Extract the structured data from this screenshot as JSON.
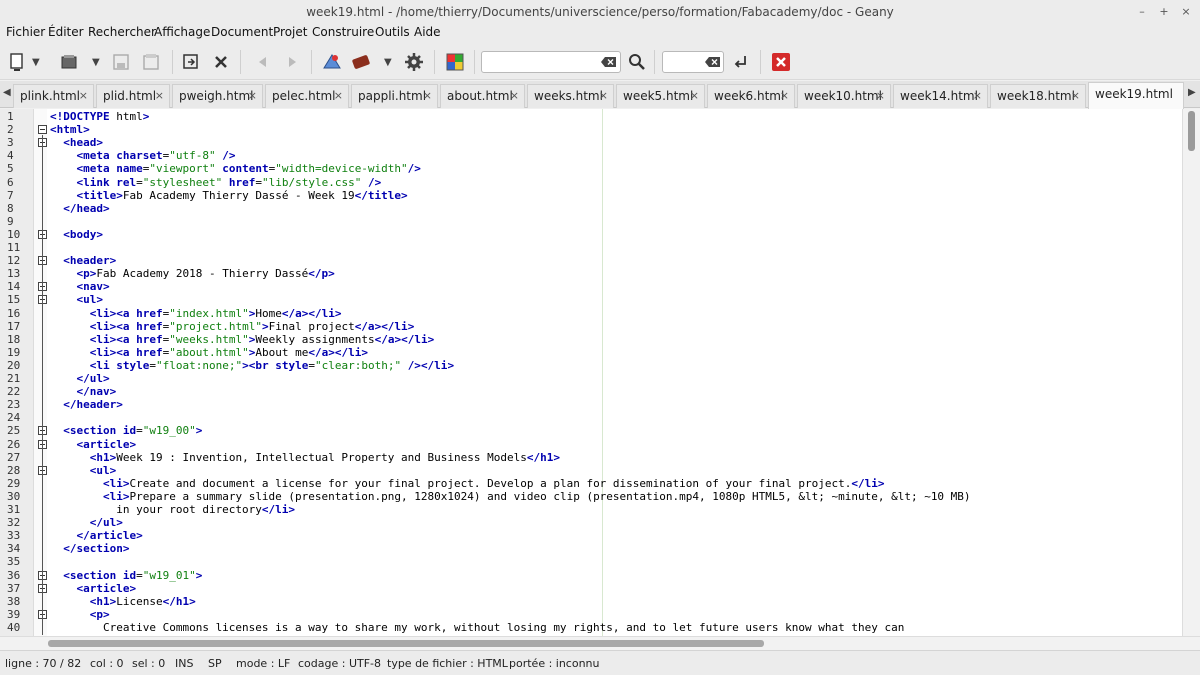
{
  "window": {
    "title": "week19.html - /home/thierry/Documents/universcience/perso/formation/Fabacademy/doc - Geany",
    "minimize": "–",
    "maximize": "+",
    "close": "×"
  },
  "menu": [
    "Fichier",
    "Éditer",
    "Rechercher",
    "Affichage",
    "Document",
    "Projet",
    "Construire",
    "Outils",
    "Aide"
  ],
  "toolbar": {
    "search_value": "",
    "goto_value": "",
    "icons": [
      "new-file-icon",
      "open-file-icon",
      "save-icon",
      "save-all-icon",
      "revert-icon",
      "close-file-icon",
      "back-icon",
      "forward-icon",
      "compile-icon",
      "build-icon",
      "preferences-icon",
      "color-chooser-icon",
      "search-icon",
      "goto-line-icon",
      "quit-icon"
    ]
  },
  "tabs": [
    {
      "label": "plink.html",
      "active": false
    },
    {
      "label": "plid.html",
      "active": false
    },
    {
      "label": "pweigh.html",
      "active": false
    },
    {
      "label": "pelec.html",
      "active": false
    },
    {
      "label": "pappli.html",
      "active": false
    },
    {
      "label": "about.html",
      "active": false
    },
    {
      "label": "weeks.html",
      "active": false
    },
    {
      "label": "week5.html",
      "active": false
    },
    {
      "label": "week6.html",
      "active": false
    },
    {
      "label": "week10.html",
      "active": false
    },
    {
      "label": "week14.html",
      "active": false
    },
    {
      "label": "week18.html",
      "active": false
    },
    {
      "label": "week19.html",
      "active": true
    }
  ],
  "tab_close_glyph": "×",
  "editor": {
    "lines": [
      "<!DOCTYPE html>",
      "<html>",
      "  <head>",
      "    <meta charset=\"utf-8\" />",
      "    <meta name=\"viewport\" content=\"width=device-width\"/>",
      "    <link rel=\"stylesheet\" href=\"lib/style.css\" />",
      "    <title>Fab Academy Thierry Dassé - Week 19</title>",
      "  </head>",
      "",
      "  <body>",
      "",
      "  <header>",
      "    <p>Fab Academy 2018 - Thierry Dassé</p>",
      "    <nav>",
      "    <ul>",
      "      <li><a href=\"index.html\">Home</a></li>",
      "      <li><a href=\"project.html\">Final project</a></li>",
      "      <li><a href=\"weeks.html\">Weekly assignments</a></li>",
      "      <li><a href=\"about.html\">About me</a></li>",
      "      <li style=\"float:none;\"><br style=\"clear:both;\" /></li>",
      "    </ul>",
      "    </nav>",
      "  </header>",
      "",
      "  <section id=\"w19_00\">",
      "    <article>",
      "      <h1>Week 19 : Invention, Intellectual Property and Business Models</h1>",
      "      <ul>",
      "        <li>Create and document a license for your final project. Develop a plan for dissemination of your final project.</li>",
      "        <li>Prepare a summary slide (presentation.png, 1280x1024) and video clip (presentation.mp4, 1080p HTML5, &lt; ~minute, &lt; ~10 MB)",
      "          in your root directory</li>",
      "      </ul>",
      "    </article>",
      "  </section>",
      "",
      "  <section id=\"w19_01\">",
      "    <article>",
      "      <h1>License</h1>",
      "      <p>",
      "        Creative Commons licenses is a way to share my work, without losing my rights, and to let future users know what they can"
    ]
  },
  "status": {
    "line": "ligne : 70 / 82",
    "col": "col : 0",
    "sel": "sel : 0",
    "ins": "INS",
    "sp": "SP",
    "mode": "mode : LF",
    "encoding": "codage : UTF-8",
    "filetype": "type de fichier : HTML",
    "scope": "portée : inconnu"
  }
}
